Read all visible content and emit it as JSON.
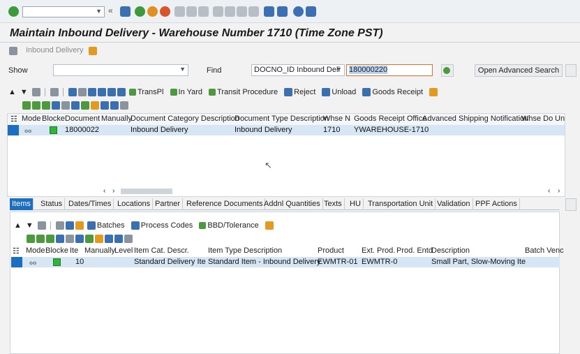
{
  "window": {
    "title": "Maintain Inbound Delivery - Warehouse Number 1710 (Time Zone PST)"
  },
  "system_toolbar": {
    "command_field_value": "",
    "icons": [
      "check-icon",
      "back-double-icon",
      "save-icon",
      "back-icon",
      "exit-icon",
      "cancel-icon",
      "print-icon",
      "find-icon",
      "find-next-icon",
      "first-page-icon",
      "prev-page-icon",
      "next-page-icon",
      "last-page-icon",
      "new-session-icon",
      "shortcut-icon",
      "help-icon",
      "customize-icon"
    ]
  },
  "app_toolbar": {
    "item_label": "Inbound Delivery"
  },
  "search": {
    "show_label": "Show",
    "show_value": "",
    "find_label": "Find",
    "find_value": "DOCNO_ID Inbound Deli",
    "search_value": "180000220",
    "advanced_search_label": "Open Advanced Search"
  },
  "header_toolbar": {
    "transpl": "TransPl",
    "in_yard": "In Yard",
    "transit_procedure": "Transit Procedure",
    "reject": "Reject",
    "unload": "Unload",
    "goods_receipt": "Goods Receipt"
  },
  "header_grid": {
    "columns": [
      "Mode",
      "Blocke",
      "Document",
      "Manually",
      "Document Category Description",
      "Document Type Description",
      "Whse N",
      "Goods Receipt Office",
      "Advanced Shipping Notification",
      "Whse Do",
      "Un"
    ],
    "rows": [
      {
        "document": "18000022",
        "doc_category": "Inbound Delivery",
        "doc_type": "Inbound Delivery",
        "whse": "1710",
        "gr_office": "YWAREHOUSE-1710"
      }
    ]
  },
  "tabs": [
    "Items",
    "Status",
    "Dates/Times",
    "Locations",
    "Partner",
    "Reference Documents",
    "Addnl Quantities",
    "Texts",
    "HU",
    "Transportation Unit",
    "Validation",
    "PPF Actions"
  ],
  "items_toolbar": {
    "batches": "Batches",
    "process_codes": "Process Codes",
    "bbd_tolerance": "BBD/Tolerance"
  },
  "items_grid": {
    "columns": [
      "Mode",
      "Blocke",
      "Ite",
      "Manually",
      "Level",
      "Item Cat. Descr.",
      "Item Type Description",
      "Product",
      "Ext. Prod.",
      "Prod. Entd",
      "Description",
      "Batch Venc"
    ],
    "rows": [
      {
        "item": "10",
        "item_cat": "Standard Delivery Ite",
        "item_type": "Standard Item - Inbound Delivery",
        "product": "EWMTR-01",
        "ext_prod": "EWMTR-0",
        "description": "Small Part, Slow-Moving Ite"
      }
    ]
  },
  "colors": {
    "selection_blue": "#1b6ec2",
    "row_highlight": "#d6e6f5",
    "status_green": "#2fb63a"
  }
}
